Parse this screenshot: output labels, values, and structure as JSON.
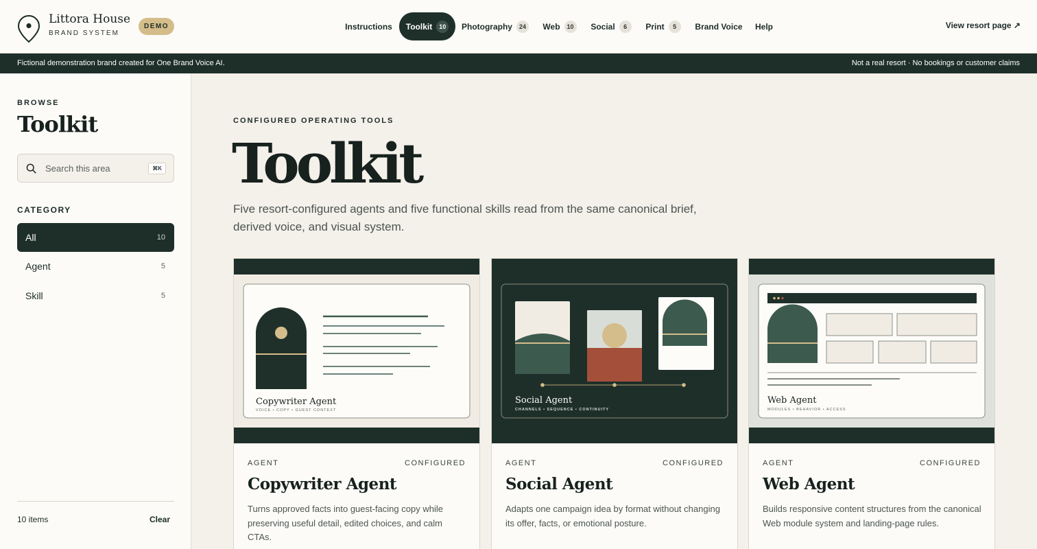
{
  "header": {
    "brand_name": "Littora House",
    "brand_sub": "BRAND SYSTEM",
    "badge": "DEMO",
    "nav": [
      {
        "label": "Instructions",
        "count": null,
        "active": false
      },
      {
        "label": "Toolkit",
        "count": "10",
        "active": true
      },
      {
        "label": "Photography",
        "count": "24",
        "active": false
      },
      {
        "label": "Web",
        "count": "10",
        "active": false
      },
      {
        "label": "Social",
        "count": "6",
        "active": false
      },
      {
        "label": "Print",
        "count": "5",
        "active": false
      },
      {
        "label": "Brand Voice",
        "count": null,
        "active": false
      },
      {
        "label": "Help",
        "count": null,
        "active": false
      }
    ],
    "view_resort": "View resort page ↗"
  },
  "banner": {
    "left": "Fictional demonstration brand created for One Brand Voice AI.",
    "right": "Not a real resort · No bookings or customer claims"
  },
  "sidebar": {
    "browse": "BROWSE",
    "title": "Toolkit",
    "search_placeholder": "Search this area",
    "search_shortcut": "⌘K",
    "category_heading": "CATEGORY",
    "categories": [
      {
        "label": "All",
        "count": "10",
        "active": true
      },
      {
        "label": "Agent",
        "count": "5",
        "active": false
      },
      {
        "label": "Skill",
        "count": "5",
        "active": false
      }
    ],
    "item_count": "10 items",
    "clear": "Clear"
  },
  "main": {
    "eyebrow": "CONFIGURED OPERATING TOOLS",
    "title": "Toolkit",
    "description": "Five resort-configured agents and five functional skills read from the same canonical brief, derived voice, and visual system.",
    "cards": [
      {
        "art_title": "Copywriter Agent",
        "art_sub": "VOICE • COPY • GUEST CONTEXT",
        "type": "AGENT",
        "status": "CONFIGURED",
        "title": "Copywriter Agent",
        "description": "Turns approved facts into guest-facing copy while preserving useful detail, edited choices, and calm CTAs."
      },
      {
        "art_title": "Social Agent",
        "art_sub": "CHANNELS • SEQUENCE • CONTINUITY",
        "type": "AGENT",
        "status": "CONFIGURED",
        "title": "Social Agent",
        "description": "Adapts one campaign idea by format without changing its offer, facts, or emotional posture."
      },
      {
        "art_title": "Web Agent",
        "art_sub": "MODULES • BEHAVIOR • ACCESS",
        "type": "AGENT",
        "status": "CONFIGURED",
        "title": "Web Agent",
        "description": "Builds responsive content structures from the canonical Web module system and landing-page rules."
      }
    ]
  },
  "colors": {
    "forest": "#1e2f2a",
    "moss": "#3d5a4f",
    "sand": "#d4bd8a",
    "terracotta": "#a44f3a",
    "cream": "#f4f0ea"
  },
  "icons": [
    "location-pin-icon",
    "search-icon",
    "external-link-arrow-icon"
  ]
}
